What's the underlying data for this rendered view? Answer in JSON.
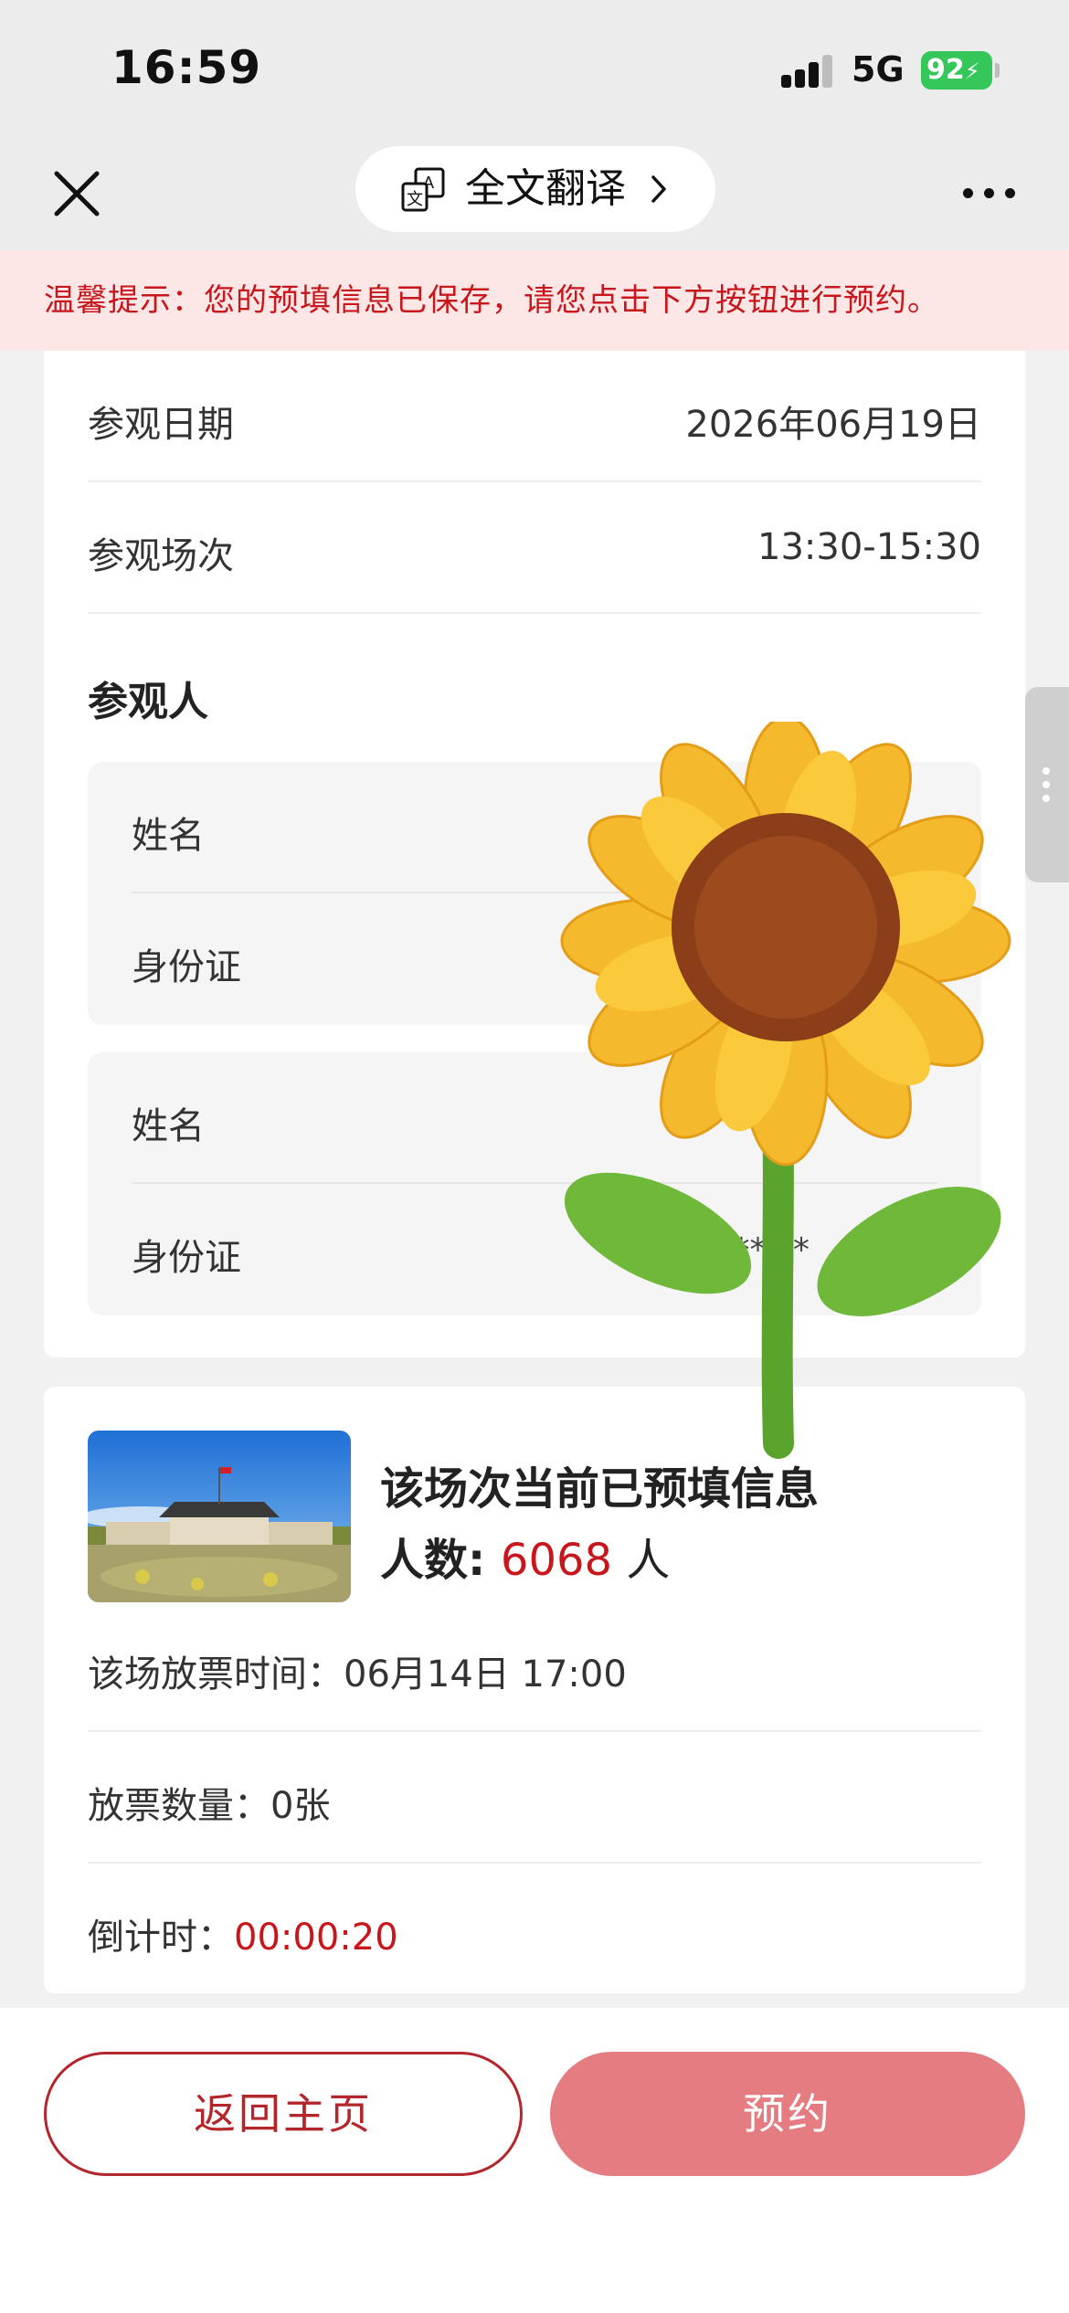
{
  "status_bar": {
    "time": "16:59",
    "network": "5G",
    "battery": "92"
  },
  "nav": {
    "translate_label": "全文翻译"
  },
  "notice": "温馨提示：您的预填信息已保存，请您点击下方按钮进行预约。",
  "visit": {
    "date_label": "参观日期",
    "date_value": "2026年06月19日",
    "session_label": "参观场次",
    "session_value": "13:30-15:30",
    "visitors_title": "参观人",
    "visitors": [
      {
        "name_label": "姓名",
        "name_value": "",
        "id_label": "身份证",
        "id_value": ""
      },
      {
        "name_label": "姓名",
        "name_value": "",
        "id_label": "身份证",
        "id_value": "**  **"
      }
    ]
  },
  "info": {
    "title": "该场次当前已预填信息",
    "count_label": "人数: ",
    "count_value": "6068",
    "count_unit": " 人",
    "release_time_label": "该场放票时间：",
    "release_time_value": "06月14日 17:00",
    "ticket_count_label": "放票数量：",
    "ticket_count_value": "0张",
    "countdown_label": "倒计时：",
    "countdown_value": "00:00:20"
  },
  "buttons": {
    "home": "返回主页",
    "book": "预约"
  },
  "colors": {
    "accent": "#c8171c",
    "book_button": "#e57c82",
    "notice_bg": "#fde6e6"
  },
  "icons": [
    "close-icon",
    "translate-icon",
    "chevron-right-icon",
    "more-icon",
    "sunflower-sticker"
  ]
}
